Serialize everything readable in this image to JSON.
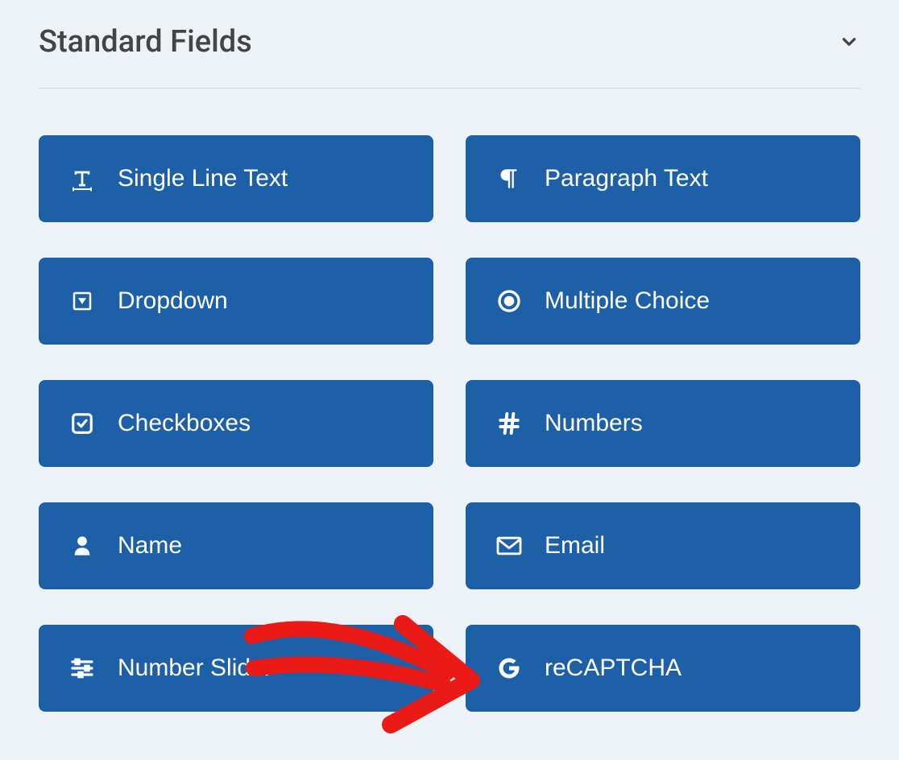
{
  "section": {
    "title": "Standard Fields"
  },
  "fields": [
    {
      "label": "Single Line Text",
      "icon": "text-icon"
    },
    {
      "label": "Paragraph Text",
      "icon": "paragraph-icon"
    },
    {
      "label": "Dropdown",
      "icon": "dropdown-icon"
    },
    {
      "label": "Multiple Choice",
      "icon": "target-icon"
    },
    {
      "label": "Checkboxes",
      "icon": "checkbox-icon"
    },
    {
      "label": "Numbers",
      "icon": "hash-icon"
    },
    {
      "label": "Name",
      "icon": "person-icon"
    },
    {
      "label": "Email",
      "icon": "envelope-icon"
    },
    {
      "label": "Number Slider",
      "icon": "sliders-icon"
    },
    {
      "label": "reCAPTCHA",
      "icon": "google-icon"
    }
  ],
  "annotation": {
    "arrow_color": "#ea1a17"
  }
}
